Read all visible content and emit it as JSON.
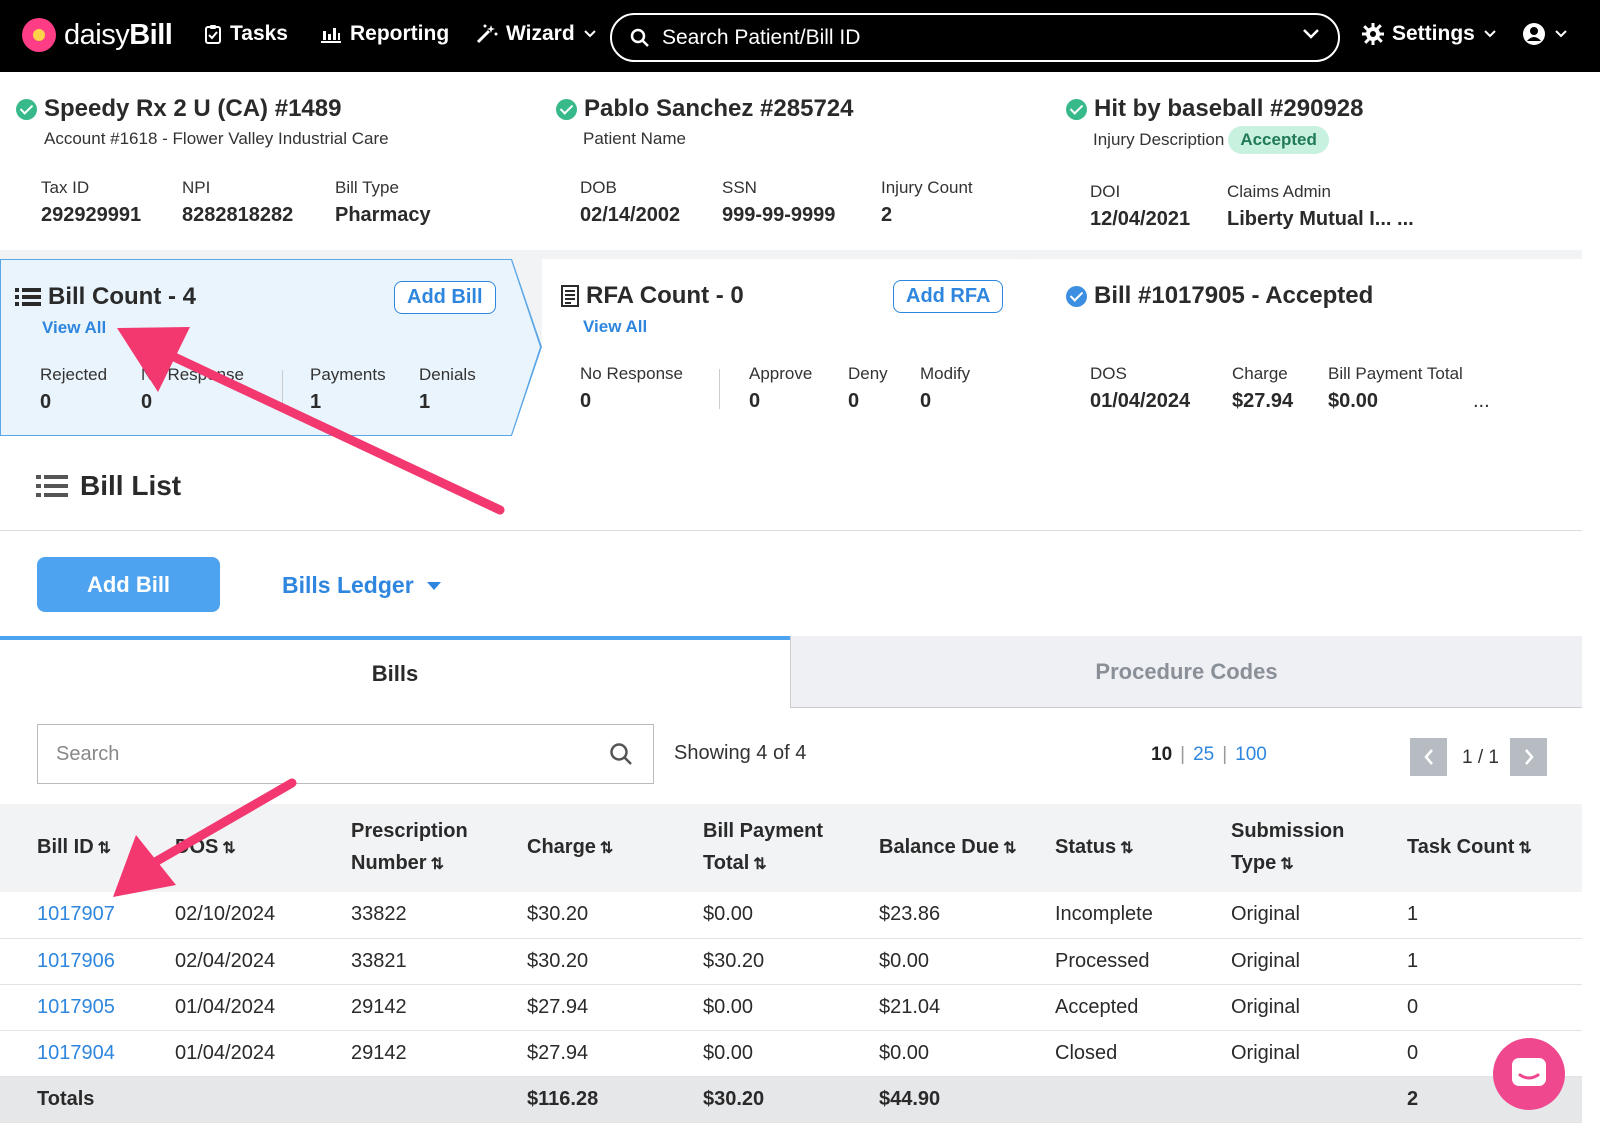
{
  "nav": {
    "brand_plain": "daisy",
    "brand_bold": "Bill",
    "tasks": "Tasks",
    "reporting": "Reporting",
    "wizard": "Wizard",
    "search_placeholder": "Search Patient/Bill ID",
    "settings": "Settings"
  },
  "provider": {
    "title": "Speedy Rx 2 U (CA) #1489",
    "account": "Account #1618 - Flower Valley Industrial Care",
    "fields": [
      {
        "label": "Tax ID",
        "value": "292929991"
      },
      {
        "label": "NPI",
        "value": "8282818282"
      },
      {
        "label": "Bill Type",
        "value": "Pharmacy"
      }
    ]
  },
  "patient": {
    "title": "Pablo Sanchez #285724",
    "subtitle": "Patient Name",
    "fields": [
      {
        "label": "DOB",
        "value": "02/14/2002"
      },
      {
        "label": "SSN",
        "value": "999-99-9999"
      },
      {
        "label": "Injury Count",
        "value": "2"
      }
    ]
  },
  "injury": {
    "title": "Hit by baseball #290928",
    "subtitle": "Injury Description",
    "badge": "Accepted",
    "fields": [
      {
        "label": "DOI",
        "value": "12/04/2021"
      },
      {
        "label": "Claims Admin",
        "value": "Liberty Mutual I... ..."
      }
    ]
  },
  "bill_count": {
    "title": "Bill Count - 4",
    "view_all": "View All",
    "add_button": "Add Bill",
    "fields": [
      {
        "label": "Rejected",
        "value": "0"
      },
      {
        "label": "No Response",
        "value": "0"
      },
      {
        "label": "Payments",
        "value": "1"
      },
      {
        "label": "Denials",
        "value": "1"
      }
    ]
  },
  "rfa_count": {
    "title": "RFA Count - 0",
    "view_all": "View All",
    "add_button": "Add RFA",
    "fields": [
      {
        "label": "No Response",
        "value": "0"
      },
      {
        "label": "Approve",
        "value": "0"
      },
      {
        "label": "Deny",
        "value": "0"
      },
      {
        "label": "Modify",
        "value": "0"
      }
    ]
  },
  "bill_detail": {
    "title": "Bill #1017905 - Accepted",
    "fields": [
      {
        "label": "DOS",
        "value": "01/04/2024"
      },
      {
        "label": "Charge",
        "value": "$27.94"
      },
      {
        "label": "Bill Payment Total",
        "value": "$0.00"
      }
    ],
    "more": "..."
  },
  "bill_list": {
    "title": "Bill List",
    "add_bill": "Add Bill",
    "ledger": "Bills Ledger",
    "tabs": [
      "Bills",
      "Procedure Codes"
    ],
    "search_placeholder": "Search",
    "showing": "Showing 4 of 4",
    "page_sizes": [
      "10",
      "25",
      "100"
    ],
    "page_sep": "|",
    "page": "1 / 1",
    "headers": [
      [
        "Bill ID"
      ],
      [
        "DOS"
      ],
      [
        "Prescription",
        "Number"
      ],
      [
        "Charge"
      ],
      [
        "Bill Payment",
        "Total"
      ],
      [
        "Balance Due"
      ],
      [
        "Status"
      ],
      [
        "Submission",
        "Type"
      ],
      [
        "Task Count"
      ]
    ],
    "rows": [
      [
        "1017907",
        "02/10/2024",
        "33822",
        "$30.20",
        "$0.00",
        "$23.86",
        "Incomplete",
        "Original",
        "1"
      ],
      [
        "1017906",
        "02/04/2024",
        "33821",
        "$30.20",
        "$30.20",
        "$0.00",
        "Processed",
        "Original",
        "1"
      ],
      [
        "1017905",
        "01/04/2024",
        "29142",
        "$27.94",
        "$0.00",
        "$21.04",
        "Accepted",
        "Original",
        "0"
      ],
      [
        "1017904",
        "01/04/2024",
        "29142",
        "$27.94",
        "$0.00",
        "$0.00",
        "Closed",
        "Original",
        "0"
      ]
    ],
    "totals": [
      "Totals",
      "",
      "",
      "$116.28",
      "$30.20",
      "$44.90",
      "",
      "",
      "2"
    ]
  },
  "colors": {
    "accent": "#2e86de",
    "primary_button": "#4da3ef",
    "success": "#37b98a",
    "annotation_arrow": "#f2386f",
    "chat": "#f0488f"
  }
}
